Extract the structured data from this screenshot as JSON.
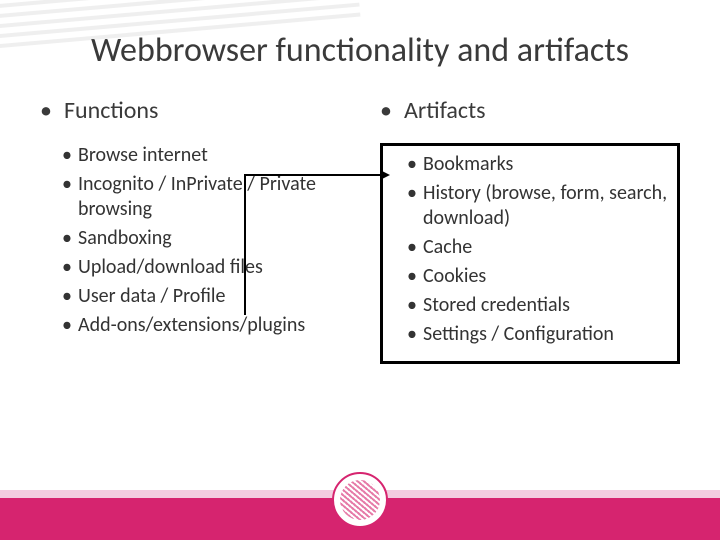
{
  "title": "Webbrowser functionality and artifacts",
  "left": {
    "heading": "Functions",
    "items": [
      "Browse internet",
      "Incognito / InPrivate / Private browsing",
      "Sandboxing",
      "Upload/download files",
      "User data / Profile",
      "Add-ons/extensions/plugins"
    ]
  },
  "right": {
    "heading": "Artifacts",
    "items": [
      "Bookmarks",
      "History (browse, form, search, download)",
      "Cache",
      "Cookies",
      "Stored credentials",
      "Settings / Configuration"
    ]
  }
}
